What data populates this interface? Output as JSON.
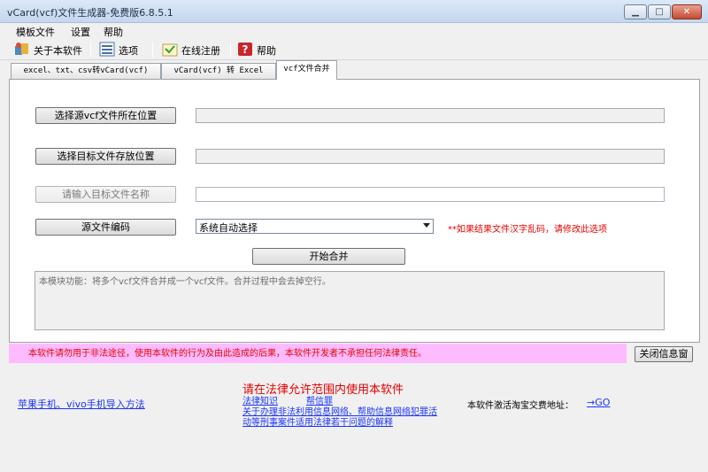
{
  "window": {
    "title": "vCard(vcf)文件生成器-免费版6.8.5.1"
  },
  "menu": {
    "items": [
      "模板文件",
      "设置",
      "帮助"
    ]
  },
  "toolbar": {
    "about": "关于本软件",
    "options": "选项",
    "register": "在线注册",
    "help": "帮助"
  },
  "tabs": [
    {
      "label": "excel、txt、csv转vCard(vcf)",
      "active": false
    },
    {
      "label": "vCard(vcf) 转 Excel",
      "active": false
    },
    {
      "label": "vcf文件合并",
      "active": true
    }
  ],
  "form": {
    "select_source_button": "选择源vcf文件所在位置",
    "select_source_value": "",
    "select_target_button": "选择目标文件存放位置",
    "select_target_value": "",
    "target_name_label": "请输入目标文件名称",
    "target_name_value": "",
    "encoding_button": "源文件编码",
    "encoding_selected": "系统自动选择",
    "encoding_hint": "**如果结果文件汉字乱码，请修改此选项",
    "start_button": "开始合并",
    "info_text": "本模块功能：将多个vcf文件合并成一个vcf文件。合并过程中会去掉空行。"
  },
  "warning": {
    "text": "本软件请勿用于非法途径，使用本软件的行为及由此造成的后果，本软件开发者不承担任何法律责任。",
    "close_button": "关闭信息窗"
  },
  "footer": {
    "left_link": "苹果手机、vivo手机导入方法",
    "legal_title": "请在法律允许范围内使用本软件",
    "legal_link_1": "法律知识",
    "legal_link_2": "帮信罪",
    "legal_link_3_line1": "关于办理非法利用信息网络、帮助信息网络犯罪活",
    "legal_link_3_line2": "动等刑事案件适用法律若干问题的解释",
    "taobao_label": "本软件激活淘宝交费地址：",
    "taobao_link": "→GO"
  },
  "colors": {
    "warning_bg": "#ffbbff",
    "warning_text": "#e60000",
    "link": "#1a35ff"
  },
  "icons": [
    "about-icon",
    "options-icon",
    "register-icon",
    "help-icon",
    "minimize-icon",
    "maximize-icon",
    "close-icon"
  ]
}
